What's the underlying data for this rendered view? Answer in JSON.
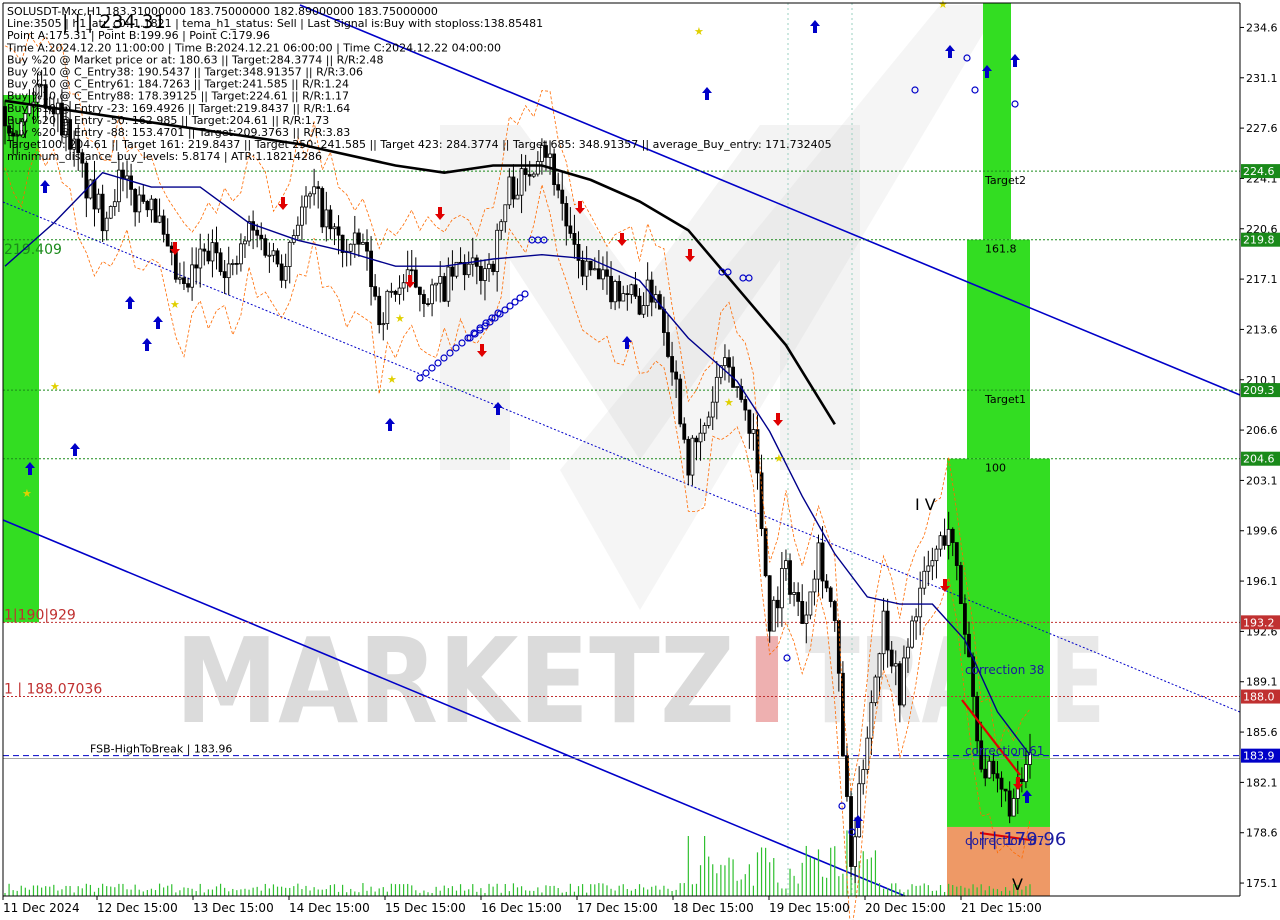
{
  "header": {
    "lines": [
      "SOLUSDT-Mxc,H1  183.31000000 183.75000000 182.89000000 183.75000000",
      "Line:3505 | h1_atr_c0: 1.1821 | tema_h1_status: Sell | Last Signal is:Buy with stoploss:138.85481",
      "Point A:175.31 | Point B:199.96 | Point C:179.96",
      "Time A:2024.12.20 11:00:00 | Time B:2024.12.21 06:00:00 | Time C:2024.12.22 04:00:00",
      "Buy %20 @ Market price or at: 180.63 || Target:284.3774 || R/R:2.48",
      "Buy %10 @ C_Entry38: 190.5437 || Target:348.91357 || R/R:3.06",
      "Buy %10 @ C_Entry61: 184.7263 || Target:241.585 || R/R:1.24",
      "Buy %10 @ C_Entry88: 178.39125 || Target:224.61 || R/R:1.17",
      "Buy %10 @ Entry -23: 169.4926 || Target:219.8437 || R/R:1.64",
      "Buy %20 @ Entry -50: 162.985 || Target:204.61 || R/R:1.73",
      "Buy %20 @ Entry -88: 153.4701 || Target:209.3763 || R/R:3.83",
      "Target100: 204.61 || Target 161: 219.8437 || Target 250: 241.585 || Target 423: 284.3774 || Target 685: 348.91357 || average_Buy_entry: 171.732405",
      "minimum_distance_buy_levels: 5.8174 | ATR:1.18214286"
    ],
    "big_label": "| | | 234.31"
  },
  "chart_data": {
    "type": "candlestick",
    "symbol": "SOLUSDT-Mxc",
    "timeframe": "H1",
    "ylim": [
      174.2,
      236.3
    ],
    "y_ticks": [
      175.1,
      178.6,
      182.1,
      185.6,
      189.1,
      192.6,
      196.1,
      199.6,
      203.1,
      206.6,
      210.1,
      213.6,
      217.1,
      220.6,
      224.1,
      227.6,
      231.1,
      234.6
    ],
    "y_tick_labels": [
      "175.1",
      "178.6",
      "182.1",
      "185.6",
      "189.1",
      "192.6",
      "196.1",
      "199.6",
      "203.1",
      "206.6",
      "210.1",
      "213.6",
      "217.1",
      "220.6",
      "224.1",
      "227.6",
      "231.1",
      "234.6"
    ],
    "x_labels": [
      "11 Dec 2024",
      "12 Dec 15:00",
      "13 Dec 15:00",
      "14 Dec 15:00",
      "15 Dec 15:00",
      "16 Dec 15:00",
      "17 Dec 15:00",
      "18 Dec 15:00",
      "19 Dec 15:00",
      "20 Dec 15:00",
      "21 Dec 15:00"
    ],
    "close_path": [
      [
        0,
        228.6
      ],
      [
        4,
        227.6
      ],
      [
        8,
        230.5
      ],
      [
        12,
        229.2
      ],
      [
        16,
        227.0
      ],
      [
        20,
        223.5
      ],
      [
        24,
        221.5
      ],
      [
        28,
        224.0
      ],
      [
        32,
        222.5
      ],
      [
        36,
        223.0
      ],
      [
        40,
        218.5
      ],
      [
        44,
        216.0
      ],
      [
        48,
        218.5
      ],
      [
        52,
        219.0
      ],
      [
        56,
        217.5
      ],
      [
        60,
        220.5
      ],
      [
        64,
        219.5
      ],
      [
        68,
        218.0
      ],
      [
        72,
        221.5
      ],
      [
        76,
        223.0
      ],
      [
        80,
        220.5
      ],
      [
        84,
        219.0
      ],
      [
        88,
        219.5
      ],
      [
        92,
        214.5
      ],
      [
        96,
        216.5
      ],
      [
        100,
        217.0
      ],
      [
        104,
        216.0
      ],
      [
        108,
        216.5
      ],
      [
        112,
        218.0
      ],
      [
        116,
        217.5
      ],
      [
        120,
        218.5
      ],
      [
        124,
        223.5
      ],
      [
        128,
        224.0
      ],
      [
        132,
        227.0
      ],
      [
        136,
        223.5
      ],
      [
        140,
        218.5
      ],
      [
        144,
        217.5
      ],
      [
        148,
        216.5
      ],
      [
        152,
        216.5
      ],
      [
        156,
        215.5
      ],
      [
        160,
        216.5
      ],
      [
        164,
        211.5
      ],
      [
        168,
        204.5
      ],
      [
        172,
        206.5
      ],
      [
        176,
        211.0
      ],
      [
        180,
        209.5
      ],
      [
        184,
        206.5
      ],
      [
        188,
        193.5
      ],
      [
        192,
        197.0
      ],
      [
        196,
        193.5
      ],
      [
        200,
        198.5
      ],
      [
        204,
        193.0
      ],
      [
        208,
        176.0
      ],
      [
        212,
        186.0
      ],
      [
        216,
        193.5
      ],
      [
        220,
        188.5
      ],
      [
        224,
        194.5
      ],
      [
        228,
        197.5
      ],
      [
        232,
        200.0
      ],
      [
        236,
        193.0
      ],
      [
        240,
        183.5
      ],
      [
        244,
        181.5
      ],
      [
        248,
        180.5
      ],
      [
        252,
        183.75
      ]
    ],
    "candles_total": 253,
    "ema_blue": [
      [
        0,
        218.0
      ],
      [
        12,
        221.0
      ],
      [
        24,
        224.5
      ],
      [
        36,
        223.5
      ],
      [
        48,
        223.5
      ],
      [
        60,
        221.0
      ],
      [
        72,
        219.8
      ],
      [
        84,
        219.0
      ],
      [
        96,
        218.0
      ],
      [
        108,
        218.0
      ],
      [
        120,
        218.5
      ],
      [
        132,
        218.8
      ],
      [
        144,
        218.5
      ],
      [
        156,
        217.0
      ],
      [
        168,
        213.0
      ],
      [
        180,
        210.0
      ],
      [
        188,
        206.5
      ],
      [
        196,
        202.0
      ],
      [
        204,
        198.0
      ],
      [
        212,
        195.0
      ],
      [
        220,
        194.5
      ],
      [
        228,
        194.5
      ],
      [
        236,
        192.0
      ],
      [
        244,
        187.0
      ],
      [
        252,
        184.0
      ]
    ],
    "sma_black": [
      [
        0,
        229.5
      ],
      [
        24,
        228.5
      ],
      [
        48,
        227.5
      ],
      [
        72,
        226.5
      ],
      [
        96,
        225.0
      ],
      [
        108,
        224.5
      ],
      [
        120,
        225.0
      ],
      [
        132,
        225.0
      ],
      [
        144,
        224.0
      ],
      [
        156,
        222.5
      ],
      [
        168,
        220.5
      ],
      [
        180,
        216.5
      ],
      [
        192,
        212.5
      ],
      [
        204,
        207.0
      ]
    ],
    "levels": [
      {
        "value": 224.61,
        "label": "224.6",
        "color": "#1a8a1a",
        "text": "Target2"
      },
      {
        "value": 219.84,
        "label": "219.8",
        "color": "#1a8a1a",
        "text": "161.8"
      },
      {
        "value": 209.38,
        "label": "209.3",
        "color": "#1a8a1a",
        "text": "Target1"
      },
      {
        "value": 204.61,
        "label": "204.6",
        "color": "#1a8a1a",
        "text": "100"
      },
      {
        "value": 193.23,
        "label": "193.2",
        "color": "#c03030",
        "text": ""
      },
      {
        "value": 188.07,
        "label": "188.0",
        "color": "#c03030",
        "text": ""
      },
      {
        "value": 183.96,
        "label": "183.9",
        "color": "#1a1aa0",
        "text": ""
      }
    ],
    "left_labels": [
      {
        "value": 219.409,
        "text": "219.409",
        "color": "#1a8a1a"
      },
      {
        "value": 193.23,
        "text": "1|190|929",
        "color": "#c03030"
      },
      {
        "value": 188.07,
        "text": "1 | 188.07036",
        "color": "#c03030"
      },
      {
        "value": 183.96,
        "text": "FSB-HighToBreak | 183.96",
        "color": "#000000"
      }
    ],
    "zone_labels": [
      "correction 38",
      "correction 61",
      "correction 87"
    ],
    "wave_labels": [
      "I V",
      "V"
    ],
    "point_c_label": "| | | 179.96"
  },
  "watermark": {
    "part1": "MARKETZ",
    "part2": "I",
    "part3": "TRADE"
  },
  "colors": {
    "bg": "#ffffff",
    "price_axis_bg": "#ffffff",
    "green_zone": "#33dd22",
    "orange_zone": "#ee9966",
    "up": "#000000",
    "down": "#000000",
    "blue": "#0000c8",
    "red": "#e00000",
    "level_green": "#1a8a1a",
    "level_red": "#c03030"
  }
}
